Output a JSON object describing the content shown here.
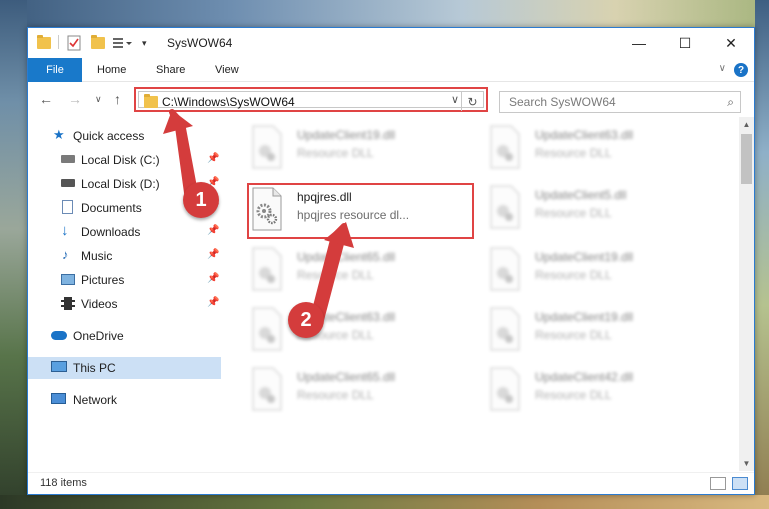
{
  "window": {
    "title": "SysWOW64",
    "minimize_glyph": "—",
    "maximize_glyph": "☐",
    "close_glyph": "✕"
  },
  "ribbon": {
    "tabs": [
      "File",
      "Home",
      "Share",
      "View"
    ]
  },
  "nav": {
    "address": "C:\\Windows\\SysWOW64",
    "search_placeholder": "Search SysWOW64"
  },
  "sidebar": {
    "items": [
      {
        "label": "Quick access",
        "icon": "star-icon"
      },
      {
        "label": "Local Disk (C:)",
        "icon": "drive-icon",
        "pinned": true
      },
      {
        "label": "Local Disk (D:)",
        "icon": "drive-icon",
        "pinned": true
      },
      {
        "label": "Documents",
        "icon": "documents-icon",
        "pinned": true
      },
      {
        "label": "Downloads",
        "icon": "download-icon",
        "pinned": true
      },
      {
        "label": "Music",
        "icon": "music-icon",
        "pinned": true
      },
      {
        "label": "Pictures",
        "icon": "pictures-icon",
        "pinned": true
      },
      {
        "label": "Videos",
        "icon": "videos-icon",
        "pinned": true
      },
      {
        "label": "OneDrive",
        "icon": "cloud-icon"
      },
      {
        "label": "This PC",
        "icon": "computer-icon",
        "selected": true
      },
      {
        "label": "Network",
        "icon": "network-icon"
      }
    ]
  },
  "files": {
    "highlighted": {
      "name": "hpqjres.dll",
      "type": "hpqjres resource dl..."
    },
    "left_column": [
      {
        "name": "UpdateClient19.dll",
        "type": "Resource DLL"
      },
      {
        "name": "UpdateClient65.dll",
        "type": "Resource DLL"
      },
      {
        "name": "UpdateClient63.dll",
        "type": "Resource DLL"
      },
      {
        "name": "UpdateClient65.dll",
        "type": "Resource DLL"
      }
    ],
    "right_column": [
      {
        "name": "UpdateClient63.dll",
        "type": "Resource DLL"
      },
      {
        "name": "UpdateClient5.dll",
        "type": "Resource DLL"
      },
      {
        "name": "UpdateClient19.dll",
        "type": "Resource DLL"
      },
      {
        "name": "UpdateClient19.dll",
        "type": "Resource DLL"
      },
      {
        "name": "UpdateClient42.dll",
        "type": "Resource DLL"
      }
    ]
  },
  "status": {
    "item_count": "118 items"
  },
  "annotations": {
    "step1": "1",
    "step2": "2",
    "color": "#d43c3c"
  }
}
